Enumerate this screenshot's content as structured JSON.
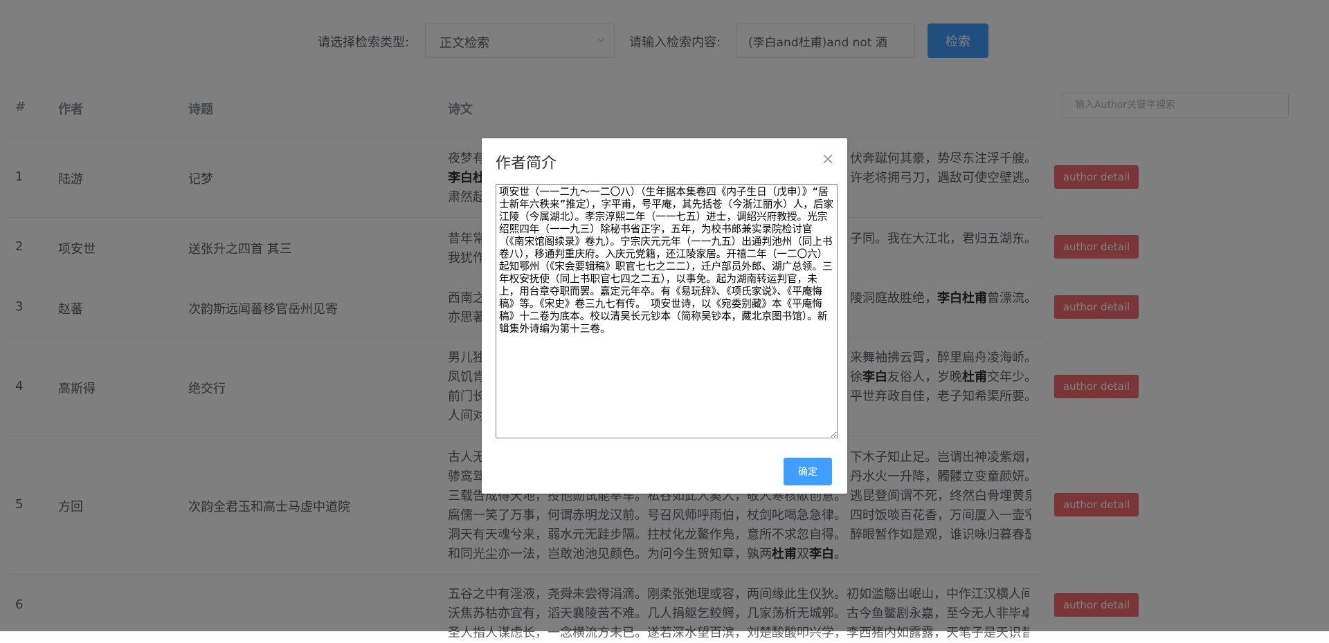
{
  "search": {
    "type_label": "请选择检索类型:",
    "type_value": "正文检索",
    "content_label": "请输入检索内容:",
    "content_value": "(李白and杜甫)and not 酒",
    "button": "检索"
  },
  "table": {
    "filter_placeholder": "输入Author关键字搜索",
    "headers": {
      "index": "#",
      "author": "作者",
      "title": "诗题",
      "text": "诗文"
    },
    "action_label": "author detail",
    "rows": [
      {
        "index": "1",
        "author": "陆游",
        "title": "记梦",
        "lines": [
          [
            [
              "夜梦有",
              false
            ],
            [
              "",
              false
            ]
          ],
          [
            [
              "李白杜",
              true
            ]
          ],
          [
            [
              "肃然起",
              false
            ]
          ]
        ],
        "right_lines": [
          "伏奔蹴何其豪，势尽东注浮千艘。",
          "许老将拥弓刀，遇敌可使空壁逃。"
        ]
      },
      {
        "index": "2",
        "author": "项安世",
        "title": "送张升之四首 其三",
        "lines": [
          [
            [
              "昔年常",
              false
            ]
          ],
          [
            [
              "我犹作",
              false
            ]
          ]
        ],
        "right_lines": [
          "子同。我在大江北，君归五湖东。"
        ]
      },
      {
        "index": "3",
        "author": "赵蕃",
        "title": "次韵斯远闻蕃移官岳州见寄",
        "lines": [
          [
            [
              "西南之",
              false
            ]
          ],
          [
            [
              "亦思著",
              false
            ]
          ]
        ],
        "right_lines": [
          "陵洞庭故胜绝，李白杜甫曾漂流。"
        ]
      },
      {
        "index": "4",
        "author": "高斯得",
        "title": "绝交行",
        "lines": [
          [
            [
              "男儿独",
              false
            ]
          ],
          [
            [
              "凤饥肯",
              false
            ]
          ],
          [
            [
              "前门长",
              false
            ]
          ],
          [
            [
              "人间对",
              false
            ]
          ]
        ],
        "right_lines": [
          "来舞袖拂云霄，醉里扁舟凌海峤。",
          "徐李白友俗人，岁晚杜甫交年少。",
          "平世弃政自佳，老子知希渠所要。"
        ]
      },
      {
        "index": "5",
        "author": "方回",
        "title": "次韵全君玉和高士马虚中道院",
        "lines": [
          [
            [
              "古人无",
              false
            ]
          ],
          [
            [
              "骖鸾驾",
              false
            ]
          ],
          [
            [
              "三载告成得天地，授他勋试能奉车。私谷如此人奚人，敬人寒核献创意。",
              false
            ]
          ],
          [
            [
              "腐儒一笑了万事，何谓赤明龙汉前。号召风师呼雨伯，杖剑叱喝急急律。",
              false
            ]
          ],
          [
            [
              "洞天有天魂兮来，弱水元无跬步隔。拄杖化龙鳌作凫，意所不求忽自得。",
              false
            ]
          ],
          [
            [
              "和同光尘亦一法，岂敢池池见颜色。为问今生贺知章，孰两",
              false
            ],
            [
              "杜甫",
              true
            ],
            [
              "双",
              false
            ],
            [
              "李白",
              true
            ],
            [
              "。",
              false
            ]
          ]
        ],
        "right_lines": [
          "下木子知止足。岂谓出神凌紫烟，",
          "丹水火一升降，髑髅立变童颜妍。",
          "逃昆登阆谓不死，终然白骨埋黄泉。",
          "四时饭啖百花香，万间厦入一壶窄。",
          "醉眼暂作如是观，谁识咏归暮春瑟。"
        ]
      },
      {
        "index": "6",
        "author": "",
        "title": "",
        "lines": [
          [
            [
              "五谷之中有淫液，尧舜未尝得涓滴。刚柔张弛理或容，两间缘此生仪狄。初如滥觞出岷山，中作江汉横人间。",
              false
            ]
          ],
          [
            [
              "沃焦苏枯亦宜有，滔天襄陵苦不难。几人捐躯乞鲛鳄，几家荡析无城郭。古今鱼鳖剧永嘉，至今无人非毕卓。",
              false
            ]
          ],
          [
            [
              "圣人指人谋虑长，一念横流方未已。遂若深水望百滨，刘楚酸酸叩兴学，李西猪内如露露，天笔子是天识昔",
              false
            ]
          ]
        ],
        "right_lines": []
      }
    ]
  },
  "dialog": {
    "title": "作者简介",
    "bio": "项安世（一一二九～一二〇八）（生年据本集卷四《内子生日（戊申）》“居士新年六秩来”推定），字平甫，号平庵，其先括苍（今浙江丽水）人，后家江陵（今属湖北）。孝宗淳熙二年（一一七五）进士，调绍兴府教授。光宗绍熙四年（一一九三）除秘书省正字，五年，为校书郎兼实录院检讨官（《南宋馆阁续录》卷九）。宁宗庆元元年（一一九五）出通判池州（同上书卷八），移通判重庆府。入庆元党籍，还江陵家居。开禧二年（一二〇六）起知鄂州（《宋会要辑稿》职官七七之二二），迁户部员外郎、湖广总领。三年权安抚使（同上书职官七四之二五），以事免。起为湖南转运判官，未上，用台章夺职而罢。嘉定元年卒。有《易玩辞》、《项氏家说》、《平庵悔稿》等。《宋史》卷三九七有传。　项安世诗，以《宛委别藏》本《平庵悔稿》十二卷为底本。校以清吴长元钞本（简称吴钞本，藏北京图书馆）。新辑集外诗编为第十三卷。",
    "ok_label": "确定"
  }
}
